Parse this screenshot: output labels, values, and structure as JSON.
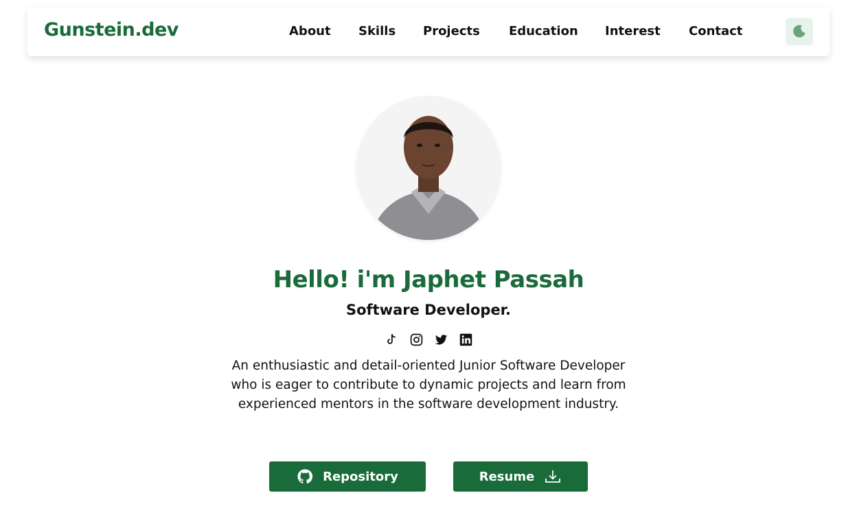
{
  "brand": {
    "logo": "Gunstein.dev",
    "accent_color": "#1a6b3a"
  },
  "nav": {
    "items": [
      {
        "label": "About"
      },
      {
        "label": "Skills"
      },
      {
        "label": "Projects"
      },
      {
        "label": "Education"
      },
      {
        "label": "Interest"
      },
      {
        "label": "Contact"
      }
    ],
    "theme_toggle_icon": "moon-icon"
  },
  "hero": {
    "greeting": "Hello! i'm Japhet Passah",
    "role": "Software Developer.",
    "bio": "An enthusiastic and detail-oriented Junior Software Developer who is eager to contribute to dynamic projects and learn from experienced mentors in the software development industry.",
    "socials": [
      "tiktok-icon",
      "instagram-icon",
      "twitter-icon",
      "linkedin-icon"
    ]
  },
  "buttons": {
    "repository_label": "Repository",
    "repository_icon": "github-icon",
    "resume_label": "Resume",
    "resume_icon": "download-icon"
  }
}
